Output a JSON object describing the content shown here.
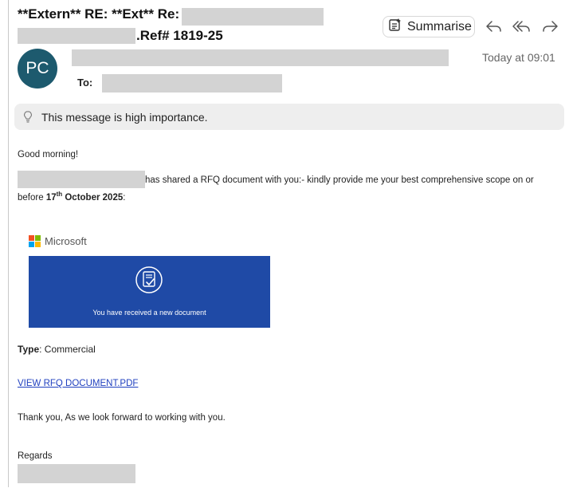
{
  "email": {
    "subject_prefix": "**Extern** RE: **Ext** Re:",
    "subject_suffix": ".Ref# 1819-25",
    "to_label": "To:",
    "avatar_initials": "PC",
    "timestamp": "Today at 09:01"
  },
  "toolbar": {
    "summarise_label": "Summarise",
    "summarise_icon": "sparkle-doc-icon",
    "reply_icon": "reply-icon",
    "reply_all_icon": "reply-all-icon",
    "forward_icon": "forward-icon"
  },
  "banner": {
    "icon": "lightbulb-icon",
    "text": "This message is high importance."
  },
  "body": {
    "greeting": "Good morning!",
    "shared_text": " has shared a RFQ document with you:- kindly provide me your best comprehensive scope on or",
    "before_text": "before ",
    "date_day": "17",
    "date_sup": "th",
    "date_rest": " October 2025",
    "date_colon": ":",
    "microsoft_label": "Microsoft",
    "document_banner_text": "You have received a new document",
    "type_label": "Type",
    "type_value": ": Commercial",
    "link_text": "VIEW RFQ DOCUMENT.PDF",
    "thanks": "Thank you, As we look forward to working with you.",
    "regards": "Regards"
  },
  "colors": {
    "avatar_bg": "#1d5a6e",
    "doc_banner_bg": "#1f4aa6",
    "link": "#1f3fbf",
    "banner_bg": "#eeeeee"
  }
}
